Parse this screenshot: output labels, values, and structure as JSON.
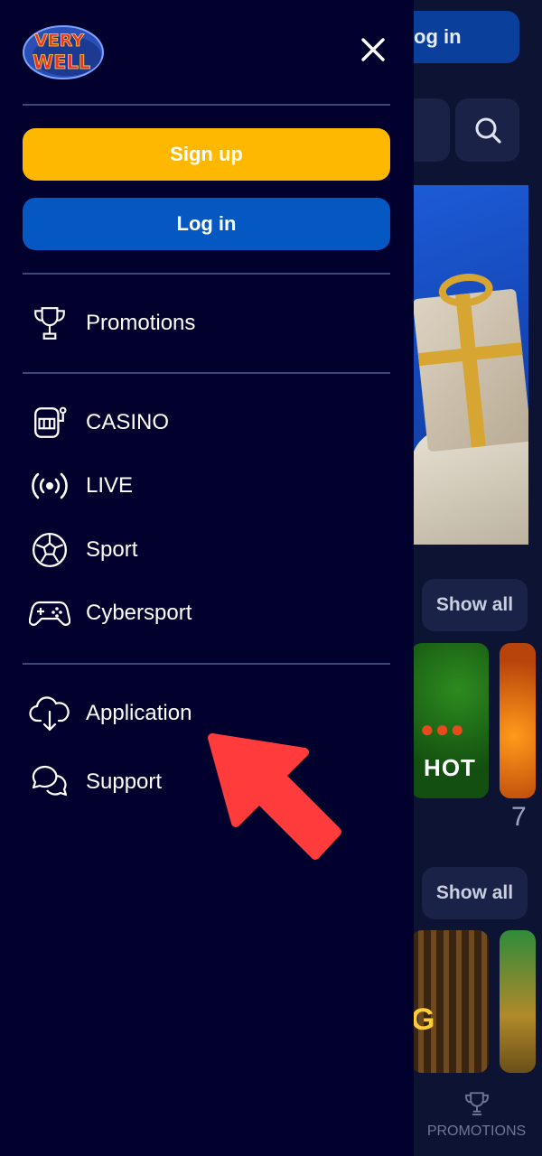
{
  "background": {
    "login_label": "og in",
    "show_all_1": "Show all",
    "show_all_2": "Show all",
    "card_hot_text": "HOT",
    "card_gold_text": "G",
    "bottom_tab_label": "PROMOTIONS",
    "side_glyph": "7"
  },
  "drawer": {
    "logo_alt": "VERY WELL",
    "buttons": {
      "signup": "Sign up",
      "login": "Log in"
    },
    "menu": {
      "promotions": "Promotions",
      "casino": "CASINO",
      "live": "LIVE",
      "sport": "Sport",
      "cybersport": "Cybersport",
      "application": "Application",
      "support": "Support"
    }
  },
  "icons": {
    "close": "close-icon",
    "trophy": "trophy-icon",
    "slot": "slot-machine-icon",
    "live": "live-broadcast-icon",
    "ball": "soccer-ball-icon",
    "gamepad": "gamepad-icon",
    "download": "cloud-download-icon",
    "chat": "chat-icon",
    "search": "search-icon"
  },
  "colors": {
    "drawer_bg": "#02002d",
    "signup": "#ffb800",
    "login": "#0558c2",
    "annotation_arrow": "#ff3b3b"
  }
}
